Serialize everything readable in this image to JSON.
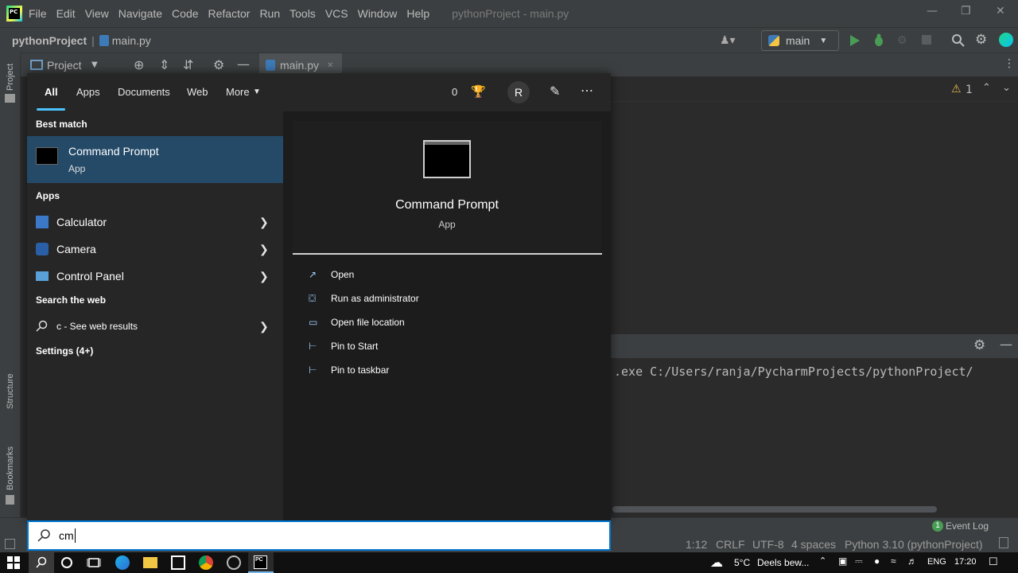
{
  "ide": {
    "menu": [
      "File",
      "Edit",
      "View",
      "Navigate",
      "Code",
      "Refactor",
      "Run",
      "Tools",
      "VCS",
      "Window",
      "Help"
    ],
    "window_title": "pythonProject - main.py",
    "nav_project": "pythonProject",
    "nav_file": "main.py",
    "run_config": "main",
    "project_tool": "Project",
    "editor_tab": "main.py",
    "warnings_count": "1",
    "left_tabs": {
      "project": "Project",
      "structure": "Structure",
      "bookmarks": "Bookmarks"
    },
    "console_line": ".exe C:/Users/ranja/PycharmProjects/pythonProject/",
    "status": {
      "event_log": "Event Log",
      "position": "1:12",
      "line_sep": "CRLF",
      "encoding": "UTF-8",
      "indent": "4 spaces",
      "interpreter": "Python 3.10 (pythonProject)"
    }
  },
  "search": {
    "tabs": [
      "All",
      "Apps",
      "Documents",
      "Web",
      "More"
    ],
    "points": "0",
    "avatar_initial": "R",
    "best_match_header": "Best match",
    "best_match": {
      "name": "Command Prompt",
      "type": "App"
    },
    "apps_header": "Apps",
    "apps": [
      "Calculator",
      "Camera",
      "Control Panel"
    ],
    "web_header": "Search the web",
    "web_query": "c",
    "web_suffix": " - See web results",
    "settings_label": "Settings (4+)",
    "preview": {
      "name": "Command Prompt",
      "type": "App",
      "actions": [
        "Open",
        "Run as administrator",
        "Open file location",
        "Pin to Start",
        "Pin to taskbar"
      ]
    },
    "query": "cm"
  },
  "taskbar": {
    "weather_temp": "5°C",
    "weather_text": "Deels bew...",
    "language": "ENG",
    "time": "17:20"
  },
  "colors": {
    "accent": "#0078d4",
    "selection": "#244a68",
    "run_green": "#499c54"
  }
}
